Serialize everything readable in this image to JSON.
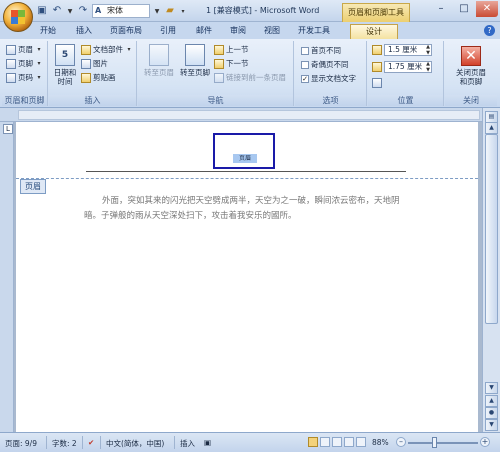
{
  "quick_access": {
    "font_name": "宋体"
  },
  "window": {
    "title": "1 [兼容模式] - Microsoft Word",
    "context_title": "页眉和页脚工具"
  },
  "tabs": [
    {
      "label": "开始"
    },
    {
      "label": "插入"
    },
    {
      "label": "页面布局"
    },
    {
      "label": "引用"
    },
    {
      "label": "邮件"
    },
    {
      "label": "审阅"
    },
    {
      "label": "视图"
    },
    {
      "label": "开发工具"
    },
    {
      "label": "设计"
    }
  ],
  "ribbon": {
    "hf_group": {
      "label": "页眉和页脚",
      "header": "页眉",
      "footer": "页脚",
      "page_number": "页码"
    },
    "insert_group": {
      "label": "插入",
      "date_time": "日期和时间",
      "doc_parts": "文档部件",
      "picture": "图片",
      "clip_art": "剪贴画"
    },
    "nav_group": {
      "label": "导航",
      "goto_header": "转至页眉",
      "goto_footer": "转至页脚",
      "prev": "上一节",
      "next": "下一节",
      "link_prev": "链接到前一条页眉"
    },
    "options_group": {
      "label": "选项",
      "first_page": "首页不同",
      "odd_even": "奇偶页不同",
      "show_text": "显示文档文字",
      "show_text_checked": true
    },
    "position_group": {
      "label": "位置",
      "header_pos": "1.5 厘米",
      "footer_pos": "1.75 厘米"
    },
    "close_group": {
      "label": "关闭",
      "close_hf": "关闭页眉和页脚"
    }
  },
  "document": {
    "header_selected_text": "页眉",
    "header_tag": "页眉",
    "body_text": "外面，突如其来的闪光把天空劈成两半，天空为之一破，瞬间浓云密布，天地阴暗。子弹般的雨从天空深处扫下，攻击着我安乐的國所。"
  },
  "statusbar": {
    "page": "页面: 9/9",
    "words": "字数: 2",
    "language": "中文(简体，中国)",
    "insert_mode": "插入",
    "zoom": "88%"
  },
  "colors": {
    "accent": "#c4d5ec",
    "context_tab": "#eccf70",
    "header_box": "#1a1aa8"
  }
}
